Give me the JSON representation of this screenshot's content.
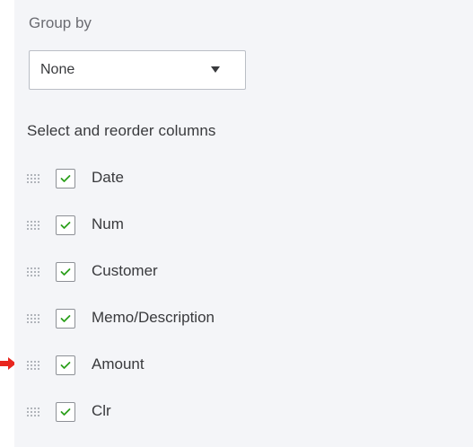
{
  "group_by": {
    "label": "Group by",
    "selected": "None"
  },
  "columns_section": {
    "heading": "Select and reorder columns",
    "columns": [
      {
        "label": "Date",
        "checked": true
      },
      {
        "label": "Num",
        "checked": true
      },
      {
        "label": "Customer",
        "checked": true
      },
      {
        "label": "Memo/Description",
        "checked": true
      },
      {
        "label": "Amount",
        "checked": true
      },
      {
        "label": "Clr",
        "checked": true
      }
    ]
  },
  "colors": {
    "checkmark": "#2ca01c",
    "pointer_arrow": "#e8261e"
  },
  "icons": {
    "drag_handle": "drag-handle-icon",
    "checkmark": "checkmark-icon",
    "dropdown": "chevron-down-icon",
    "pointer": "red-arrow-icon"
  }
}
